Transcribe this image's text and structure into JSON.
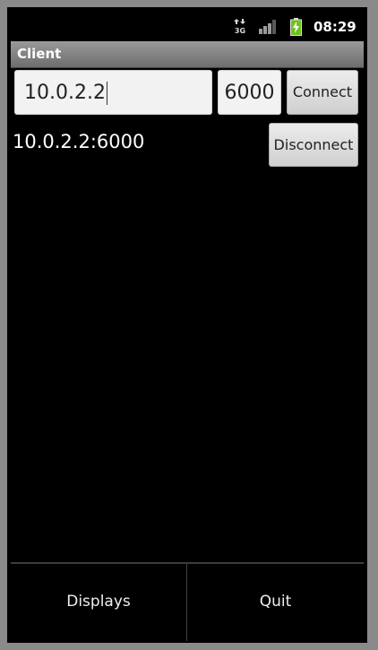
{
  "status_bar": {
    "network_type": "3G",
    "time": "08:29",
    "icons": [
      "data-arrows-3g-icon",
      "signal-bars-icon",
      "battery-charging-icon"
    ]
  },
  "app": {
    "title": "Client"
  },
  "connection_form": {
    "host_value": "10.0.2.2",
    "port_value": "6000",
    "connect_label": "Connect"
  },
  "connection": {
    "address": "10.0.2.2:6000",
    "disconnect_label": "Disconnect"
  },
  "bottom_bar": {
    "displays_label": "Displays",
    "quit_label": "Quit"
  },
  "colors": {
    "background": "#000000",
    "frame": "#8a8a8a",
    "battery_green": "#6fc21b"
  }
}
